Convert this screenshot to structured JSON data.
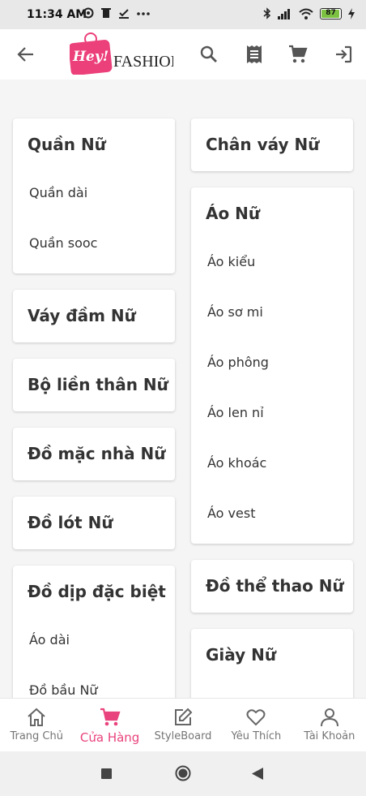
{
  "status_bar": {
    "time": "11:34 AM",
    "battery": "87"
  },
  "app_bar": {
    "logo_hey": "Hey!",
    "logo_text": "FASHION"
  },
  "colors": {
    "accent": "#e9437d",
    "text": "#333333",
    "nav_inactive": "#757575",
    "background": "#f5f5f5"
  },
  "categories_left": [
    {
      "title": "Quần Nữ",
      "items": [
        "Quần dài",
        "Quần sooc"
      ]
    },
    {
      "title": "Váy đầm Nữ",
      "items": []
    },
    {
      "title": "Bộ liền thân Nữ",
      "items": []
    },
    {
      "title": "Đồ mặc nhà Nữ",
      "items": []
    },
    {
      "title": "Đồ lót Nữ",
      "items": []
    },
    {
      "title": "Đồ dịp đặc biệt",
      "items": [
        "Áo dài",
        "Đồ bầu Nữ"
      ]
    }
  ],
  "categories_right": [
    {
      "title": "Chân váy Nữ",
      "items": []
    },
    {
      "title": "Áo Nữ",
      "items": [
        "Áo kiểu",
        "Áo sơ mi",
        "Áo phông",
        "Áo len nỉ",
        "Áo khoác",
        "Áo vest"
      ]
    },
    {
      "title": "Đồ thể thao Nữ",
      "items": []
    },
    {
      "title": "Giày Nữ",
      "items": []
    }
  ],
  "bottom_nav": [
    {
      "label": "Trang Chủ",
      "icon": "home-icon",
      "active": false
    },
    {
      "label": "Cửa Hàng",
      "icon": "cart-icon",
      "active": true
    },
    {
      "label": "StyleBoard",
      "icon": "edit-icon",
      "active": false
    },
    {
      "label": "Yêu Thích",
      "icon": "heart-icon",
      "active": false
    },
    {
      "label": "Tài Khoản",
      "icon": "person-icon",
      "active": false
    }
  ]
}
